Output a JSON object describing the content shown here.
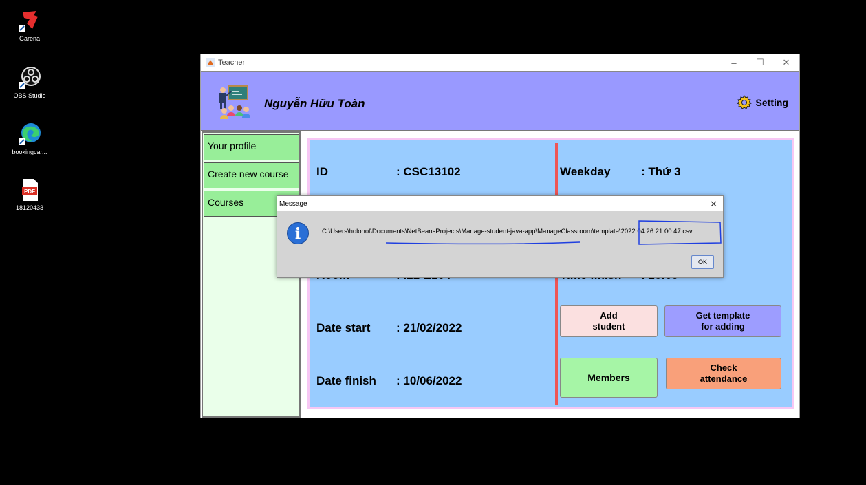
{
  "desktop": {
    "icons": [
      {
        "label": "Garena",
        "icon": "garena-icon"
      },
      {
        "label": "OBS Studio",
        "icon": "obs-icon"
      },
      {
        "label": "bookingcar...",
        "icon": "edge-icon"
      },
      {
        "label": "18120433",
        "icon": "pdf-icon"
      }
    ]
  },
  "window": {
    "title": "Teacher",
    "minimize": "–",
    "maximize": "☐",
    "close": "✕"
  },
  "header": {
    "teacher_name": "Nguyễn Hữu Toàn",
    "setting_label": "Setting",
    "color": "#9999ff"
  },
  "sidebar": {
    "items": [
      {
        "label": "Your profile"
      },
      {
        "label": "Create new course"
      },
      {
        "label": "Courses"
      }
    ]
  },
  "course": {
    "id_label": "ID",
    "id_value": ": CSC13102",
    "weekday_label": "Weekday",
    "weekday_value": ": Thứ 3",
    "room_label": "Room",
    "room_value": ": I21-E104",
    "time_finish_label": "Time finish",
    "time_finish_value": ": 20:00",
    "date_start_label": "Date start",
    "date_start_value": ": 21/02/2022",
    "date_finish_label": "Date finish",
    "date_finish_value": ": 10/06/2022"
  },
  "buttons": {
    "add_student_line1": "Add",
    "add_student_line2": "student",
    "get_template_line1": "Get template",
    "get_template_line2": "for adding",
    "members": "Members",
    "check_line1": "Check",
    "check_line2": "attendance"
  },
  "dialog": {
    "title": "Message",
    "message": "C:\\Users\\holohol\\Documents\\NetBeansProjects\\Manage-student-java-app\\ManageClassroom\\template\\2022.04.26.21.00.47.csv",
    "ok": "OK"
  }
}
